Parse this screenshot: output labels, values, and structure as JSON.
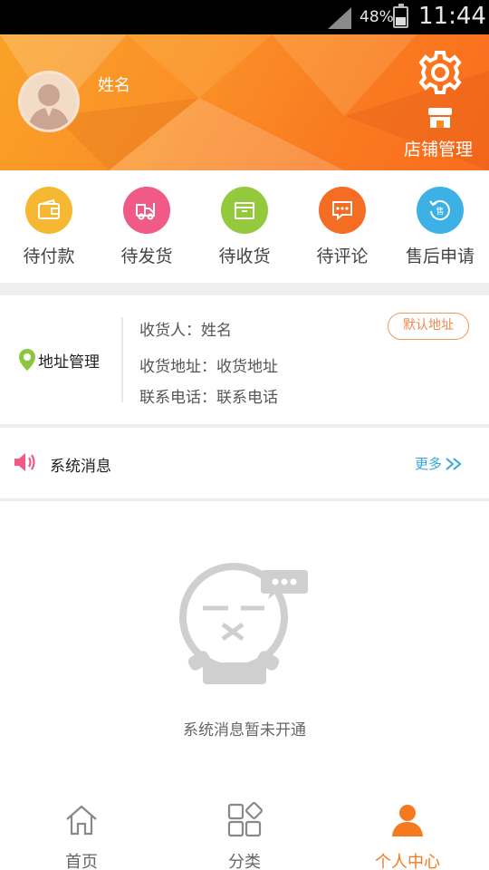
{
  "status_bar": {
    "battery": "48%",
    "time": "11:44"
  },
  "header": {
    "username": "姓名",
    "shop_manage_label": "店铺管理",
    "icons": [
      "avatar",
      "settings-icon",
      "shop-icon"
    ]
  },
  "orders": [
    {
      "label": "待付款",
      "icon": "wallet-icon",
      "color": "#f6b733"
    },
    {
      "label": "待发货",
      "icon": "truck-icon",
      "color": "#ef5b86"
    },
    {
      "label": "待收货",
      "icon": "box-icon",
      "color": "#95c93d"
    },
    {
      "label": "待评论",
      "icon": "comment-icon",
      "color": "#f46d22"
    },
    {
      "label": "售后申请",
      "icon": "after-sale-icon",
      "color": "#3db1e6"
    }
  ],
  "address": {
    "manage_label": "地址管理",
    "receiver": "收货人：姓名",
    "address": "收货地址：收货地址",
    "phone": "联系电话：联系电话",
    "default_label": "默认地址"
  },
  "system_message": {
    "title": "系统消息",
    "more": "更多",
    "empty_text": "系统消息暂未开通"
  },
  "tabbar": {
    "items": [
      {
        "label": "首页",
        "icon": "home-icon",
        "active": false
      },
      {
        "label": "分类",
        "icon": "category-icon",
        "active": false
      },
      {
        "label": "个人中心",
        "icon": "person-icon",
        "active": true
      }
    ]
  },
  "colors": {
    "accent": "#f57a1f",
    "link": "#36a7dc"
  }
}
